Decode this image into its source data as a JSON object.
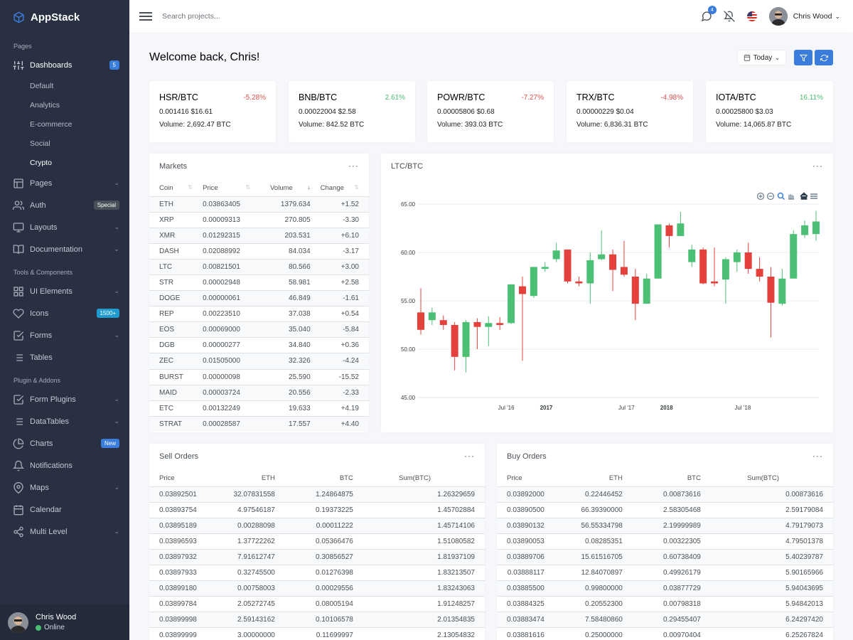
{
  "brand": "AppStack",
  "sidebar": {
    "sections": [
      {
        "header": "Pages"
      },
      {
        "header": "Tools & Components"
      },
      {
        "header": "Plugin & Addons"
      }
    ],
    "dashboards": {
      "label": "Dashboards",
      "badge": "5",
      "subitems": [
        "Default",
        "Analytics",
        "E-commerce",
        "Social",
        "Crypto"
      ]
    },
    "pages_items": [
      {
        "label": "Pages",
        "icon": "layout-icon"
      },
      {
        "label": "Auth",
        "icon": "users-icon",
        "badge": "Special"
      },
      {
        "label": "Layouts",
        "icon": "monitor-icon"
      },
      {
        "label": "Documentation",
        "icon": "book-icon"
      }
    ],
    "tools_items": [
      {
        "label": "UI Elements",
        "icon": "grid-icon"
      },
      {
        "label": "Icons",
        "icon": "heart-icon",
        "badge": "1500+"
      },
      {
        "label": "Forms",
        "icon": "check-square-icon"
      },
      {
        "label": "Tables",
        "icon": "list-icon"
      }
    ],
    "plugin_items": [
      {
        "label": "Form Plugins",
        "icon": "check-square-icon"
      },
      {
        "label": "DataTables",
        "icon": "list-icon"
      },
      {
        "label": "Charts",
        "icon": "pie-chart-icon",
        "badge": "New"
      },
      {
        "label": "Notifications",
        "icon": "bell-icon"
      },
      {
        "label": "Maps",
        "icon": "map-pin-icon"
      },
      {
        "label": "Calendar",
        "icon": "calendar-icon"
      },
      {
        "label": "Multi Level",
        "icon": "share-icon"
      }
    ],
    "user": {
      "name": "Chris Wood",
      "status": "Online"
    }
  },
  "topbar": {
    "search_placeholder": "Search projects...",
    "messages_count": "4",
    "user_name": "Chris Wood"
  },
  "welcome": "Welcome back, Chris!",
  "date_button": "Today",
  "tickers": [
    {
      "pair": "HSR/BTC",
      "change": "-5.28%",
      "dir": "neg",
      "price": "0.001416 $16.61",
      "volume": "Volume: 2,692.47 BTC"
    },
    {
      "pair": "BNB/BTC",
      "change": "2.61%",
      "dir": "pos",
      "price": "0.00022004 $2.58",
      "volume": "Volume: 842.52 BTC"
    },
    {
      "pair": "POWR/BTC",
      "change": "-7.27%",
      "dir": "neg",
      "price": "0.00005806 $0.68",
      "volume": "Volume: 393.03 BTC"
    },
    {
      "pair": "TRX/BTC",
      "change": "-4.98%",
      "dir": "neg",
      "price": "0.00000229 $0.04",
      "volume": "Volume: 6,836.31 BTC"
    },
    {
      "pair": "IOTA/BTC",
      "change": "16.11%",
      "dir": "pos",
      "price": "0.00025800 $3.03",
      "volume": "Volume: 14,065.87 BTC"
    }
  ],
  "markets": {
    "title": "Markets",
    "columns": [
      "Coin",
      "Price",
      "Volume",
      "Change"
    ],
    "rows": [
      [
        "ETH",
        "0.03863405",
        "1379.634",
        "+1.52"
      ],
      [
        "XRP",
        "0.00009313",
        "270.805",
        "-3.30"
      ],
      [
        "XMR",
        "0.01292315",
        "203.531",
        "+6.10"
      ],
      [
        "DASH",
        "0.02088992",
        "84.034",
        "-3.17"
      ],
      [
        "LTC",
        "0.00821501",
        "80.566",
        "+3.00"
      ],
      [
        "STR",
        "0.00002948",
        "58.981",
        "+2.58"
      ],
      [
        "DOGE",
        "0.00000061",
        "46.849",
        "-1.61"
      ],
      [
        "REP",
        "0.00223510",
        "37.038",
        "+0.54"
      ],
      [
        "EOS",
        "0.00069000",
        "35.040",
        "-5.84"
      ],
      [
        "DGB",
        "0.00000277",
        "34.840",
        "+0.36"
      ],
      [
        "ZEC",
        "0.01505000",
        "32.326",
        "-4.24"
      ],
      [
        "BURST",
        "0.00000098",
        "25.590",
        "-15.52"
      ],
      [
        "MAID",
        "0.00003724",
        "20.556",
        "-2.33"
      ],
      [
        "ETC",
        "0.00132249",
        "19.633",
        "+4.19"
      ],
      [
        "STRAT",
        "0.00028587",
        "17.557",
        "+4.40"
      ]
    ]
  },
  "chart_title": "LTC/BTC",
  "chart_data": {
    "type": "candlestick",
    "ylim": [
      45,
      65
    ],
    "yticks": [
      "65.00",
      "60.00",
      "55.00",
      "50.00",
      "45.00"
    ],
    "xticks": [
      {
        "label": "Jul '16",
        "pos": 0.22,
        "bold": false
      },
      {
        "label": "2017",
        "pos": 0.32,
        "bold": true
      },
      {
        "label": "Jul '17",
        "pos": 0.52,
        "bold": false
      },
      {
        "label": "2018",
        "pos": 0.62,
        "bold": true
      },
      {
        "label": "Jul '18",
        "pos": 0.81,
        "bold": false
      }
    ],
    "candles": [
      [
        53.8,
        52.0,
        56.3,
        51.5
      ],
      [
        53.0,
        53.8,
        54.3,
        52.5
      ],
      [
        53.0,
        52.5,
        53.5,
        52.0
      ],
      [
        52.5,
        49.2,
        52.8,
        47.8
      ],
      [
        49.2,
        52.8,
        53.0,
        47.6
      ],
      [
        52.8,
        52.3,
        53.2,
        50.0
      ],
      [
        52.3,
        52.7,
        53.4,
        50.3
      ],
      [
        52.7,
        52.5,
        53.3,
        52.0
      ],
      [
        52.7,
        56.7,
        56.7,
        52.6
      ],
      [
        56.5,
        55.7,
        57.5,
        48.8
      ],
      [
        55.5,
        58.5,
        58.5,
        55.3
      ],
      [
        58.3,
        58.5,
        59.0,
        58.0
      ],
      [
        59.3,
        60.2,
        61.0,
        59.0
      ],
      [
        60.3,
        57.0,
        60.3,
        56.8
      ],
      [
        57.0,
        56.8,
        57.5,
        56.5
      ],
      [
        56.8,
        59.2,
        60.0,
        54.7
      ],
      [
        59.3,
        59.8,
        62.3,
        59.2
      ],
      [
        59.8,
        58.2,
        60.3,
        56.0
      ],
      [
        58.5,
        57.7,
        61.2,
        57.5
      ],
      [
        57.5,
        54.7,
        58.3,
        53.0
      ],
      [
        54.7,
        57.3,
        57.8,
        54.7
      ],
      [
        57.3,
        62.9,
        62.9,
        57.3
      ],
      [
        62.8,
        61.7,
        63.0,
        60.5
      ],
      [
        61.7,
        63.0,
        64.2,
        61.7
      ],
      [
        59.0,
        60.3,
        60.8,
        58.5
      ],
      [
        60.3,
        56.8,
        60.5,
        56.7
      ],
      [
        57.0,
        56.8,
        60.5,
        56.5
      ],
      [
        57.2,
        59.3,
        59.5,
        54.7
      ],
      [
        59.0,
        60.0,
        60.3,
        58.0
      ],
      [
        60.0,
        58.3,
        61.0,
        57.8
      ],
      [
        58.3,
        57.5,
        59.5,
        57.0
      ],
      [
        57.5,
        54.8,
        58.5,
        51.2
      ],
      [
        54.7,
        57.3,
        58.3,
        54.5
      ],
      [
        57.3,
        61.9,
        62.3,
        57.3
      ],
      [
        61.8,
        62.8,
        63.3,
        61.5
      ],
      [
        61.9,
        63.2,
        64.3,
        61.2
      ]
    ]
  },
  "sell_orders": {
    "title": "Sell Orders",
    "columns": [
      "Price",
      "ETH",
      "BTC",
      "Sum(BTC)"
    ],
    "rows": [
      [
        "0.03892501",
        "32.07831558",
        "1.24864875",
        "1.26329659"
      ],
      [
        "0.03893754",
        "4.97546187",
        "0.19373225",
        "1.45702884"
      ],
      [
        "0.03895189",
        "0.00288098",
        "0.00011222",
        "1.45714106"
      ],
      [
        "0.03896593",
        "1.37722262",
        "0.05366476",
        "1.51080582"
      ],
      [
        "0.03897932",
        "7.91612747",
        "0.30856527",
        "1.81937109"
      ],
      [
        "0.03897933",
        "0.32745500",
        "0.01276398",
        "1.83213507"
      ],
      [
        "0.03899180",
        "0.00758003",
        "0.00029556",
        "1.83243063"
      ],
      [
        "0.03899784",
        "2.05272745",
        "0.08005194",
        "1.91248257"
      ],
      [
        "0.03899998",
        "2.59143162",
        "0.10106578",
        "2.01354835"
      ],
      [
        "0.03899999",
        "3.00000000",
        "0.11699997",
        "2.13054832"
      ]
    ]
  },
  "buy_orders": {
    "title": "Buy Orders",
    "columns": [
      "Price",
      "ETH",
      "BTC",
      "Sum(BTC)"
    ],
    "rows": [
      [
        "0.03892000",
        "0.22446452",
        "0.00873616",
        "0.00873616"
      ],
      [
        "0.03890500",
        "66.39390000",
        "2.58305468",
        "2.59179084"
      ],
      [
        "0.03890132",
        "56.55334798",
        "2.19999989",
        "4.79179073"
      ],
      [
        "0.03890053",
        "0.08285351",
        "0.00322305",
        "4.79501378"
      ],
      [
        "0.03889706",
        "15.61516705",
        "0.60738409",
        "5.40239787"
      ],
      [
        "0.03888117",
        "12.84070897",
        "0.49926179",
        "5.90165966"
      ],
      [
        "0.03885500",
        "0.99800000",
        "0.03877729",
        "5.94043695"
      ],
      [
        "0.03884325",
        "0.20552300",
        "0.00798318",
        "5.94842013"
      ],
      [
        "0.03883474",
        "7.58480860",
        "0.29455407",
        "6.24297420"
      ],
      [
        "0.03881616",
        "0.25000000",
        "0.00970404",
        "6.25267824"
      ]
    ]
  },
  "colors": {
    "accent": "#3b7ddd",
    "up": "#4bbf73",
    "down": "#e5413c",
    "sidebar": "#293042"
  }
}
